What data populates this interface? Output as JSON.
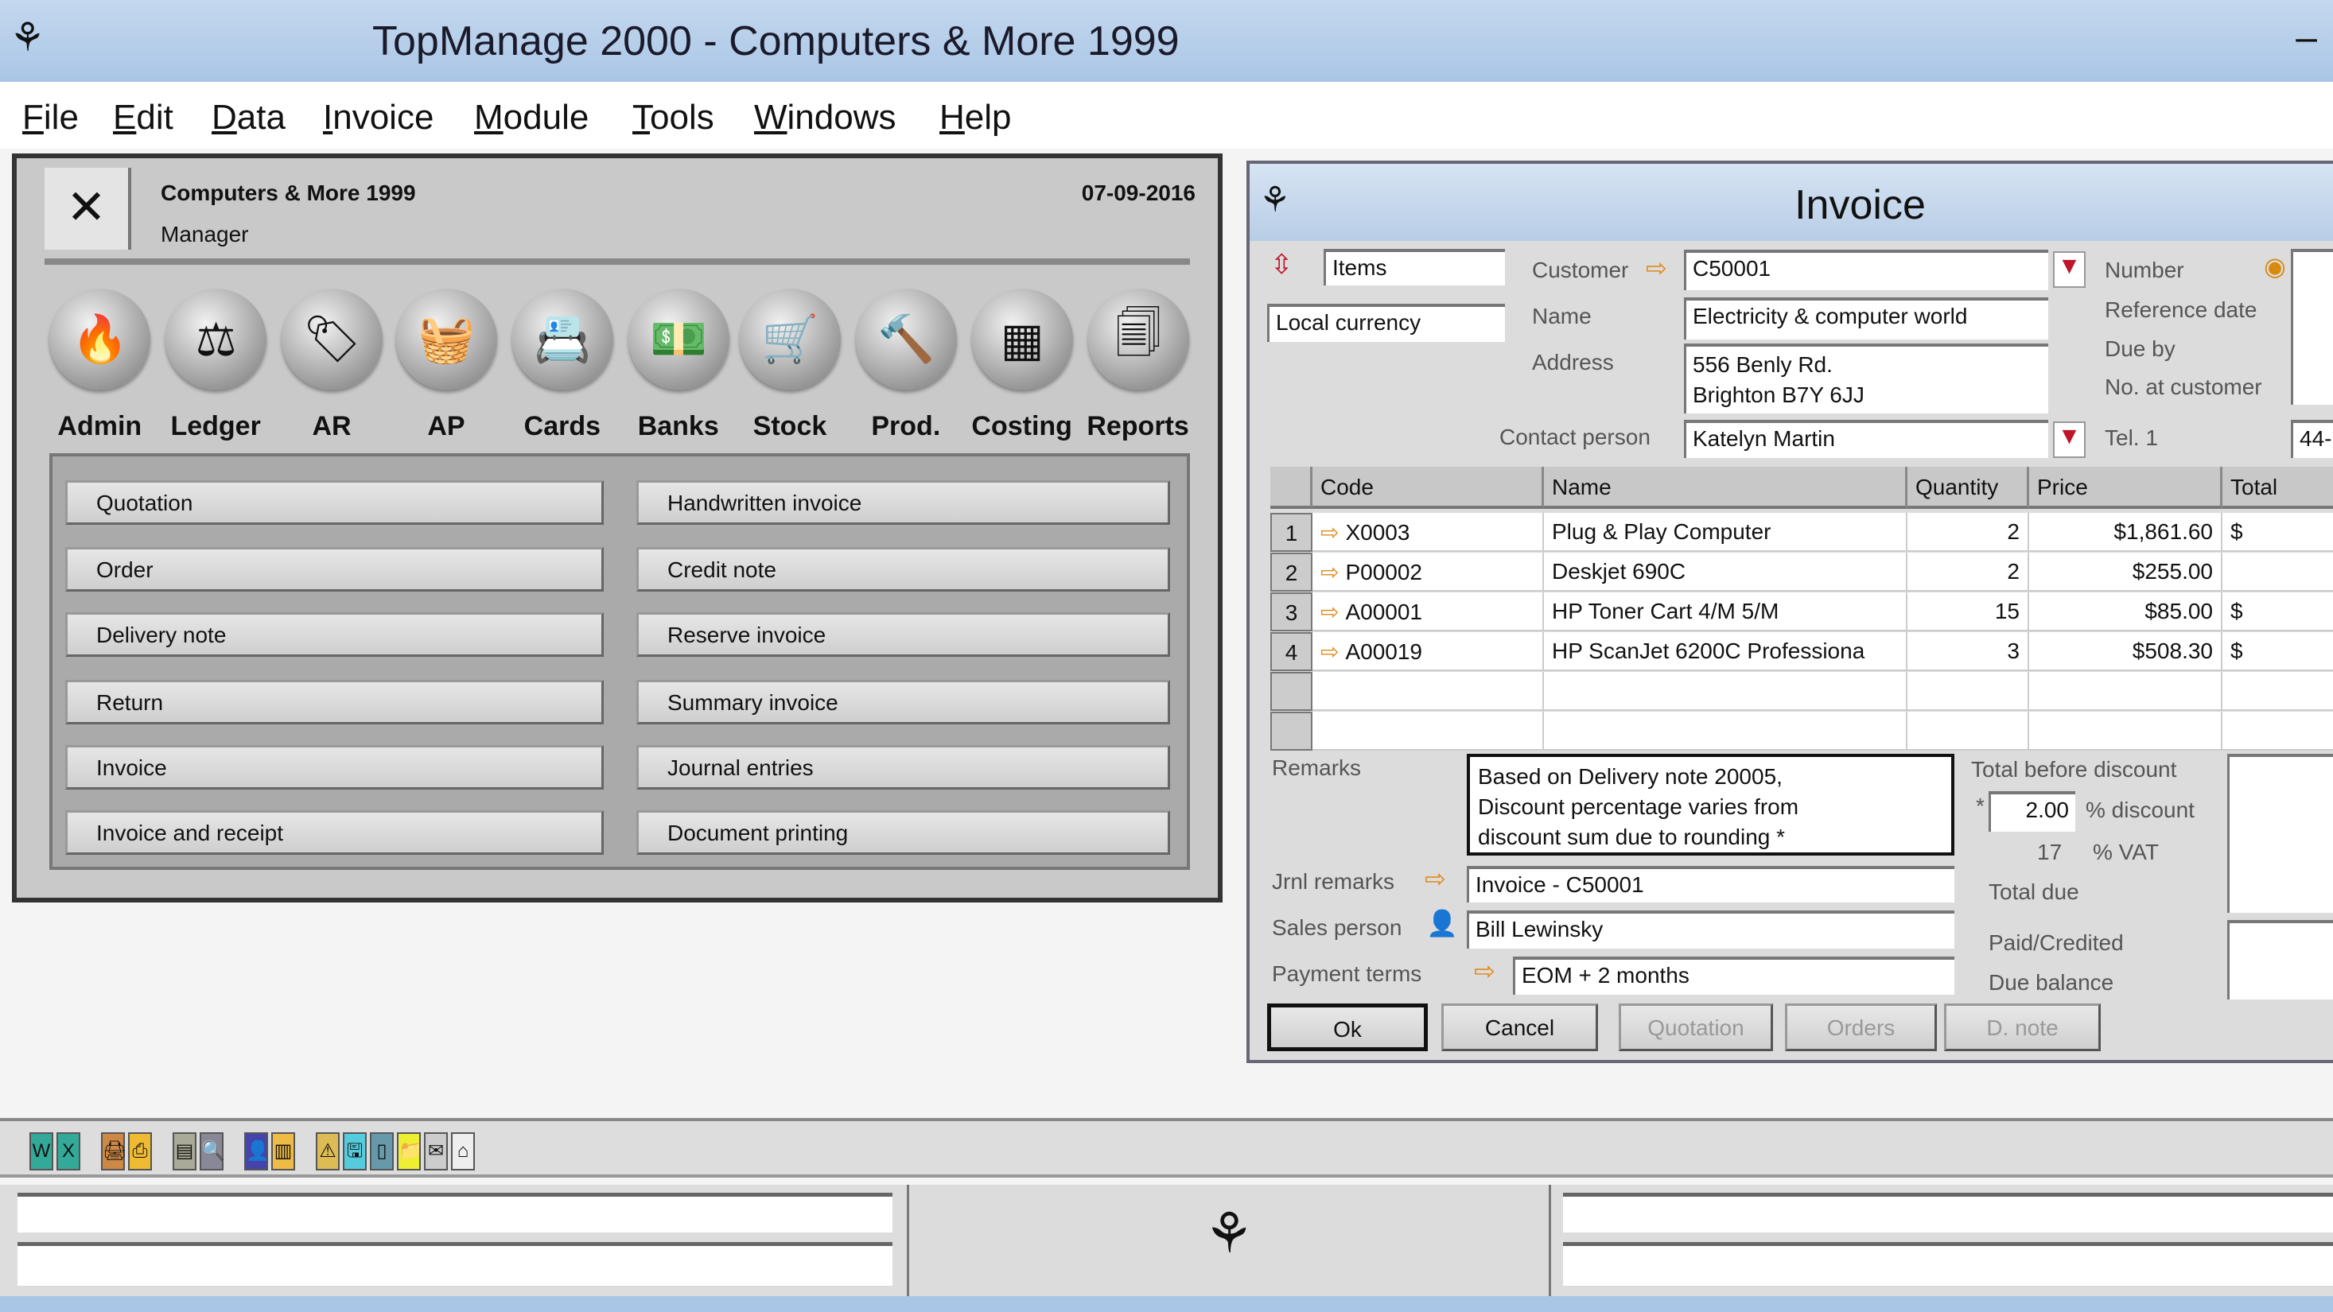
{
  "app": {
    "title": "TopManage 2000 - Computers & More 1999",
    "minimize": "–"
  },
  "menu": [
    "File",
    "Edit",
    "Data",
    "Invoice",
    "Module",
    "Tools",
    "Windows",
    "Help"
  ],
  "panel": {
    "company": "Computers & More 1999",
    "role": "Manager",
    "date": "07-09-2016",
    "modules": [
      {
        "label": "Admin",
        "icon": "admin-icon",
        "glyph": "🔥"
      },
      {
        "label": "Ledger",
        "icon": "scales-icon",
        "glyph": "⚖"
      },
      {
        "label": "AR",
        "icon": "ar-tag-icon",
        "glyph": "🏷"
      },
      {
        "label": "AP",
        "icon": "basket-icon",
        "glyph": "🧺"
      },
      {
        "label": "Cards",
        "icon": "cards-icon",
        "glyph": "📇"
      },
      {
        "label": "Banks",
        "icon": "banknote-icon",
        "glyph": "💵"
      },
      {
        "label": "Stock",
        "icon": "hand-truck-icon",
        "glyph": "🛒"
      },
      {
        "label": "Prod.",
        "icon": "hammer-icon",
        "glyph": "🔨"
      },
      {
        "label": "Costing",
        "icon": "grid-icon",
        "glyph": "▦"
      },
      {
        "label": "Reports",
        "icon": "documents-icon",
        "glyph": "🗐"
      }
    ],
    "documents_left": [
      "Quotation",
      "Order",
      "Delivery note",
      "Return",
      "Invoice",
      "Invoice and receipt"
    ],
    "documents_right": [
      "Handwritten invoice",
      "Credit note",
      "Reserve invoice",
      "Summary invoice",
      "Journal entries",
      "Document printing"
    ]
  },
  "invoice": {
    "title": "Invoice",
    "items": "Items",
    "currency": "Local currency",
    "labels": {
      "customer": "Customer",
      "name": "Name",
      "address": "Address",
      "contact": "Contact person",
      "number": "Number",
      "ref_date": "Reference date",
      "due_by": "Due by",
      "no_at_customer": "No. at customer",
      "tel": "Tel. 1",
      "remarks": "Remarks",
      "jrnl": "Jrnl remarks",
      "sales": "Sales person",
      "terms": "Payment terms",
      "total_before": "Total before discount",
      "discount": "% discount",
      "vat": "% VAT",
      "total_due": "Total due",
      "paid": "Paid/Credited",
      "balance": "Due balance",
      "star": "*"
    },
    "customer": "C50001",
    "name": "Electricity & computer world",
    "address1": "556 Benly Rd.",
    "address2": "Brighton B7Y 6JJ",
    "contact": "Katelyn Martin",
    "tel": "44-",
    "columns": [
      "Code",
      "Name",
      "Quantity",
      "Price",
      "Total"
    ],
    "rows": [
      {
        "n": "1",
        "code": "X0003",
        "name": "Plug & Play Computer",
        "qty": "2",
        "price": "$1,861.60",
        "total": "$"
      },
      {
        "n": "2",
        "code": "P00002",
        "name": "Deskjet 690C",
        "qty": "2",
        "price": "$255.00",
        "total": ""
      },
      {
        "n": "3",
        "code": "A00001",
        "name": "HP Toner Cart 4/M 5/M",
        "qty": "15",
        "price": "$85.00",
        "total": "$"
      },
      {
        "n": "4",
        "code": "A00019",
        "name": "HP ScanJet 6200C Professiona",
        "qty": "3",
        "price": "$508.30",
        "total": "$"
      }
    ],
    "remarks": [
      "Based on Delivery note 20005,",
      "Discount percentage varies from",
      "discount sum due to rounding *"
    ],
    "jrnl": "Invoice - C50001",
    "sales": "Bill Lewinsky",
    "terms": "EOM + 2 months",
    "discount": "2.00",
    "vat": "17",
    "buttons": {
      "ok": "Ok",
      "cancel": "Cancel",
      "quotation": "Quotation",
      "orders": "Orders",
      "dnote": "D. note"
    }
  },
  "toolbar": [
    "W",
    "X",
    "🖨",
    "⎙",
    "▤",
    "🔍",
    "👤",
    "▥",
    "⚠",
    "🖫",
    "▯",
    "📁",
    "✉",
    "⌂"
  ],
  "colors": {
    "titlebar": "#b8d0ea",
    "panel": "#c9c9c9",
    "accent_arrow": "#e08a1c",
    "dropdown_red": "#c0142a"
  }
}
